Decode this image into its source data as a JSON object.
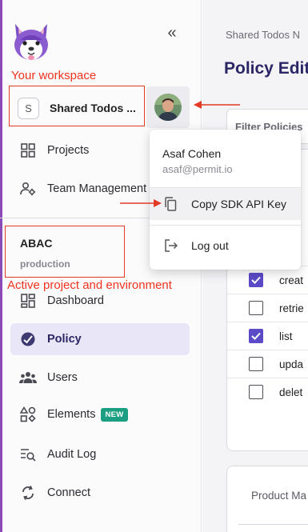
{
  "sidebar": {
    "collapse_icon": "double-chevron-left-icon",
    "workspace": {
      "badge": "S",
      "name": "Shared Todos ..."
    },
    "nav_top": [
      {
        "label": "Projects",
        "icon": "grid-icon"
      },
      {
        "label": "Team Management",
        "icon": "users-gear-icon"
      }
    ],
    "project": {
      "name": "ABAC",
      "environment": "production"
    },
    "nav_main": [
      {
        "label": "Dashboard",
        "icon": "dashboard-icon"
      },
      {
        "label": "Policy",
        "icon": "policy-icon",
        "active": true
      },
      {
        "label": "Users",
        "icon": "users-icon"
      },
      {
        "label": "Elements",
        "icon": "elements-icon",
        "badge": "NEW"
      },
      {
        "label": "Audit Log",
        "icon": "audit-log-icon"
      },
      {
        "label": "Connect",
        "icon": "connect-icon"
      }
    ]
  },
  "annotations": {
    "workspace": "Your workspace",
    "project": "Active project and environment",
    "color": "#f0331f"
  },
  "user_menu": {
    "name": "Asaf Cohen",
    "email": "asaf@permit.io",
    "items": [
      {
        "label": "Copy SDK API Key",
        "icon": "copy-icon"
      },
      {
        "label": "Log out",
        "icon": "logout-icon"
      }
    ]
  },
  "main": {
    "breadcrumb": "Shared Todos N",
    "title": "Policy Edit",
    "filter_label": "Filter Policies",
    "permissions": [
      {
        "label": "creat",
        "checked": true
      },
      {
        "label": "retrie",
        "checked": false
      },
      {
        "label": "list",
        "checked": true
      },
      {
        "label": "upda",
        "checked": false
      },
      {
        "label": "delet",
        "checked": false
      }
    ],
    "product_card_label": "Product Ma"
  },
  "colors": {
    "accent": "#5b4bc8",
    "title": "#2b2666",
    "new_badge": "#1c9e82",
    "active_bg": "#e9e6f7"
  }
}
